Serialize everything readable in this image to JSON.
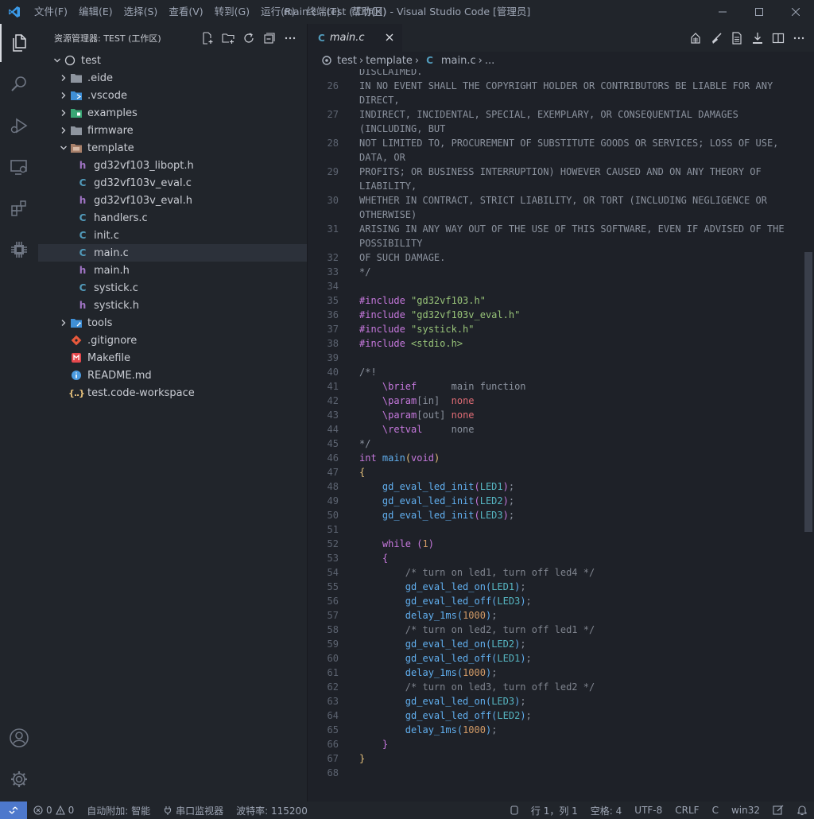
{
  "titlebar": {
    "menus": [
      "文件(F)",
      "编辑(E)",
      "选择(S)",
      "查看(V)",
      "转到(G)",
      "运行(R)",
      "终端(T)",
      "帮助(H)"
    ],
    "title": "main.c - test (工作区) - Visual Studio Code [管理员]"
  },
  "sidebar": {
    "title": "资源管理器: TEST (工作区)",
    "tree": [
      {
        "label": "test",
        "depth": 0,
        "twisty": "down",
        "icon": "root-circle-icon"
      },
      {
        "label": ".eide",
        "depth": 1,
        "twisty": "right",
        "icon": "folder-icon"
      },
      {
        "label": ".vscode",
        "depth": 1,
        "twisty": "right",
        "icon": "vscode-folder-icon"
      },
      {
        "label": "examples",
        "depth": 1,
        "twisty": "right",
        "icon": "examples-folder-icon"
      },
      {
        "label": "firmware",
        "depth": 1,
        "twisty": "right",
        "icon": "folder-icon"
      },
      {
        "label": "template",
        "depth": 1,
        "twisty": "down",
        "icon": "template-folder-icon"
      },
      {
        "label": "gd32vf103_libopt.h",
        "depth": 2,
        "twisty": "",
        "icon": "h-file-icon"
      },
      {
        "label": "gd32vf103v_eval.c",
        "depth": 2,
        "twisty": "",
        "icon": "c-file-icon"
      },
      {
        "label": "gd32vf103v_eval.h",
        "depth": 2,
        "twisty": "",
        "icon": "h-file-icon"
      },
      {
        "label": "handlers.c",
        "depth": 2,
        "twisty": "",
        "icon": "c-file-icon"
      },
      {
        "label": "init.c",
        "depth": 2,
        "twisty": "",
        "icon": "c-file-icon"
      },
      {
        "label": "main.c",
        "depth": 2,
        "twisty": "",
        "icon": "c-file-icon",
        "selected": true
      },
      {
        "label": "main.h",
        "depth": 2,
        "twisty": "",
        "icon": "h-file-icon"
      },
      {
        "label": "systick.c",
        "depth": 2,
        "twisty": "",
        "icon": "c-file-icon"
      },
      {
        "label": "systick.h",
        "depth": 2,
        "twisty": "",
        "icon": "h-file-icon"
      },
      {
        "label": "tools",
        "depth": 1,
        "twisty": "right",
        "icon": "tools-folder-icon"
      },
      {
        "label": ".gitignore",
        "depth": 1,
        "twisty": "",
        "icon": "git-file-icon"
      },
      {
        "label": "Makefile",
        "depth": 1,
        "twisty": "",
        "icon": "makefile-icon"
      },
      {
        "label": "README.md",
        "depth": 1,
        "twisty": "",
        "icon": "info-file-icon"
      },
      {
        "label": "test.code-workspace",
        "depth": 1,
        "twisty": "",
        "icon": "json-file-icon"
      }
    ]
  },
  "tab": {
    "icon_letter": "C",
    "label": "main.c"
  },
  "breadcrumb": {
    "root": "test",
    "folder": "template",
    "file_letter": "C",
    "file": "main.c",
    "tail": "..."
  },
  "code": [
    {
      "n": "",
      "parts": [
        [
          "DISCLAIMED.",
          "plain"
        ]
      ]
    },
    {
      "n": "26",
      "parts": [
        [
          "IN NO EVENT SHALL THE COPYRIGHT HOLDER OR CONTRIBUTORS BE LIABLE FOR ANY",
          "plain"
        ]
      ]
    },
    {
      "n": "",
      "parts": [
        [
          "DIRECT,",
          "plain"
        ]
      ]
    },
    {
      "n": "27",
      "parts": [
        [
          "INDIRECT, INCIDENTAL, SPECIAL, EXEMPLARY, OR CONSEQUENTIAL DAMAGES",
          "plain"
        ]
      ]
    },
    {
      "n": "",
      "parts": [
        [
          "(INCLUDING, BUT",
          "plain"
        ]
      ]
    },
    {
      "n": "28",
      "parts": [
        [
          "NOT LIMITED TO, PROCUREMENT OF SUBSTITUTE GOODS OR SERVICES; LOSS OF USE,",
          "plain"
        ]
      ]
    },
    {
      "n": "",
      "parts": [
        [
          "DATA, OR",
          "plain"
        ]
      ]
    },
    {
      "n": "29",
      "parts": [
        [
          "PROFITS; OR BUSINESS INTERRUPTION) HOWEVER CAUSED AND ON ANY THEORY OF",
          "plain"
        ]
      ]
    },
    {
      "n": "",
      "parts": [
        [
          "LIABILITY,",
          "plain"
        ]
      ]
    },
    {
      "n": "30",
      "parts": [
        [
          "WHETHER IN CONTRACT, STRICT LIABILITY, OR TORT (INCLUDING NEGLIGENCE OR",
          "plain"
        ]
      ]
    },
    {
      "n": "",
      "parts": [
        [
          "OTHERWISE)",
          "plain"
        ]
      ]
    },
    {
      "n": "31",
      "parts": [
        [
          "ARISING IN ANY WAY OUT OF THE USE OF THIS SOFTWARE, EVEN IF ADVISED OF THE",
          "plain"
        ]
      ]
    },
    {
      "n": "",
      "parts": [
        [
          "POSSIBILITY",
          "plain"
        ]
      ]
    },
    {
      "n": "32",
      "parts": [
        [
          "OF SUCH DAMAGE.",
          "plain"
        ]
      ]
    },
    {
      "n": "33",
      "parts": [
        [
          "*/",
          "plain"
        ]
      ]
    },
    {
      "n": "34",
      "parts": []
    },
    {
      "n": "35",
      "parts": [
        [
          "#include ",
          "pre"
        ],
        [
          "\"gd32vf103.h\"",
          "str"
        ]
      ]
    },
    {
      "n": "36",
      "parts": [
        [
          "#include ",
          "pre"
        ],
        [
          "\"gd32vf103v_eval.h\"",
          "str"
        ]
      ]
    },
    {
      "n": "37",
      "parts": [
        [
          "#include ",
          "pre"
        ],
        [
          "\"systick.h\"",
          "str"
        ]
      ]
    },
    {
      "n": "38",
      "parts": [
        [
          "#include ",
          "pre"
        ],
        [
          "<stdio.h>",
          "str"
        ]
      ]
    },
    {
      "n": "39",
      "parts": []
    },
    {
      "n": "40",
      "parts": [
        [
          "/*!",
          "plain"
        ]
      ]
    },
    {
      "n": "41",
      "parts": [
        [
          "    ",
          "plain"
        ],
        [
          "\\brief",
          "doc"
        ],
        [
          "      main function",
          "plain"
        ]
      ]
    },
    {
      "n": "42",
      "parts": [
        [
          "    ",
          "plain"
        ],
        [
          "\\param",
          "doc"
        ],
        [
          "[in]",
          "plain"
        ],
        [
          "  none",
          "red"
        ]
      ]
    },
    {
      "n": "43",
      "parts": [
        [
          "    ",
          "plain"
        ],
        [
          "\\param",
          "doc"
        ],
        [
          "[out]",
          "plain"
        ],
        [
          " none",
          "red"
        ]
      ]
    },
    {
      "n": "44",
      "parts": [
        [
          "    ",
          "plain"
        ],
        [
          "\\retval",
          "doc"
        ],
        [
          "     none",
          "plain"
        ]
      ]
    },
    {
      "n": "45",
      "parts": [
        [
          "*/",
          "plain"
        ]
      ]
    },
    {
      "n": "46",
      "parts": [
        [
          "int ",
          "type"
        ],
        [
          "main",
          "fn"
        ],
        [
          "(",
          "br1"
        ],
        [
          "void",
          "type"
        ],
        [
          ")",
          "br1"
        ]
      ]
    },
    {
      "n": "47",
      "parts": [
        [
          "{",
          "br1"
        ]
      ]
    },
    {
      "n": "48",
      "parts": [
        [
          "    ",
          "plain"
        ],
        [
          "gd_eval_led_init",
          "fn"
        ],
        [
          "(",
          "br2"
        ],
        [
          "LED1",
          "const"
        ],
        [
          ")",
          "br2"
        ],
        [
          ";",
          "plain"
        ]
      ]
    },
    {
      "n": "49",
      "parts": [
        [
          "    ",
          "plain"
        ],
        [
          "gd_eval_led_init",
          "fn"
        ],
        [
          "(",
          "br2"
        ],
        [
          "LED2",
          "const"
        ],
        [
          ")",
          "br2"
        ],
        [
          ";",
          "plain"
        ]
      ]
    },
    {
      "n": "50",
      "parts": [
        [
          "    ",
          "plain"
        ],
        [
          "gd_eval_led_init",
          "fn"
        ],
        [
          "(",
          "br2"
        ],
        [
          "LED3",
          "const"
        ],
        [
          ")",
          "br2"
        ],
        [
          ";",
          "plain"
        ]
      ]
    },
    {
      "n": "51",
      "parts": []
    },
    {
      "n": "52",
      "parts": [
        [
          "    ",
          "plain"
        ],
        [
          "while",
          "kw"
        ],
        [
          " ",
          "plain"
        ],
        [
          "(",
          "br2"
        ],
        [
          "1",
          "num"
        ],
        [
          ")",
          "br2"
        ]
      ]
    },
    {
      "n": "53",
      "parts": [
        [
          "    ",
          "plain"
        ],
        [
          "{",
          "br2"
        ]
      ]
    },
    {
      "n": "54",
      "parts": [
        [
          "        ",
          "plain"
        ],
        [
          "/* turn on led1, turn off led4 */",
          "com"
        ]
      ]
    },
    {
      "n": "55",
      "parts": [
        [
          "        ",
          "plain"
        ],
        [
          "gd_eval_led_on",
          "fn"
        ],
        [
          "(",
          "br3"
        ],
        [
          "LED1",
          "const"
        ],
        [
          ")",
          "br3"
        ],
        [
          ";",
          "plain"
        ]
      ]
    },
    {
      "n": "56",
      "parts": [
        [
          "        ",
          "plain"
        ],
        [
          "gd_eval_led_off",
          "fn"
        ],
        [
          "(",
          "br3"
        ],
        [
          "LED3",
          "const"
        ],
        [
          ")",
          "br3"
        ],
        [
          ";",
          "plain"
        ]
      ]
    },
    {
      "n": "57",
      "parts": [
        [
          "        ",
          "plain"
        ],
        [
          "delay_1ms",
          "fn"
        ],
        [
          "(",
          "br3"
        ],
        [
          "1000",
          "num"
        ],
        [
          ")",
          "br3"
        ],
        [
          ";",
          "plain"
        ]
      ]
    },
    {
      "n": "58",
      "parts": [
        [
          "        ",
          "plain"
        ],
        [
          "/* turn on led2, turn off led1 */",
          "com"
        ]
      ]
    },
    {
      "n": "59",
      "parts": [
        [
          "        ",
          "plain"
        ],
        [
          "gd_eval_led_on",
          "fn"
        ],
        [
          "(",
          "br3"
        ],
        [
          "LED2",
          "const"
        ],
        [
          ")",
          "br3"
        ],
        [
          ";",
          "plain"
        ]
      ]
    },
    {
      "n": "60",
      "parts": [
        [
          "        ",
          "plain"
        ],
        [
          "gd_eval_led_off",
          "fn"
        ],
        [
          "(",
          "br3"
        ],
        [
          "LED1",
          "const"
        ],
        [
          ")",
          "br3"
        ],
        [
          ";",
          "plain"
        ]
      ]
    },
    {
      "n": "61",
      "parts": [
        [
          "        ",
          "plain"
        ],
        [
          "delay_1ms",
          "fn"
        ],
        [
          "(",
          "br3"
        ],
        [
          "1000",
          "num"
        ],
        [
          ")",
          "br3"
        ],
        [
          ";",
          "plain"
        ]
      ]
    },
    {
      "n": "62",
      "parts": [
        [
          "        ",
          "plain"
        ],
        [
          "/* turn on led3, turn off led2 */",
          "com"
        ]
      ]
    },
    {
      "n": "63",
      "parts": [
        [
          "        ",
          "plain"
        ],
        [
          "gd_eval_led_on",
          "fn"
        ],
        [
          "(",
          "br3"
        ],
        [
          "LED3",
          "const"
        ],
        [
          ")",
          "br3"
        ],
        [
          ";",
          "plain"
        ]
      ]
    },
    {
      "n": "64",
      "parts": [
        [
          "        ",
          "plain"
        ],
        [
          "gd_eval_led_off",
          "fn"
        ],
        [
          "(",
          "br3"
        ],
        [
          "LED2",
          "const"
        ],
        [
          ")",
          "br3"
        ],
        [
          ";",
          "plain"
        ]
      ]
    },
    {
      "n": "65",
      "parts": [
        [
          "        ",
          "plain"
        ],
        [
          "delay_1ms",
          "fn"
        ],
        [
          "(",
          "br3"
        ],
        [
          "1000",
          "num"
        ],
        [
          ")",
          "br3"
        ],
        [
          ";",
          "plain"
        ]
      ]
    },
    {
      "n": "66",
      "parts": [
        [
          "    ",
          "plain"
        ],
        [
          "}",
          "br2"
        ]
      ]
    },
    {
      "n": "67",
      "parts": [
        [
          "}",
          "br1"
        ]
      ]
    },
    {
      "n": "68",
      "parts": []
    }
  ],
  "statusbar": {
    "errors": "0",
    "warnings": "0",
    "auto_attach": "自动附加: 智能",
    "serial_monitor": "串口监视器",
    "baud_rate": "波特率: 115200",
    "position": "行 1，列 1",
    "spaces": "空格: 4",
    "encoding": "UTF-8",
    "eol": "CRLF",
    "language": "C",
    "platform": "win32"
  },
  "colors": {
    "accent": "#4d78cc",
    "c_file": "#519aba",
    "h_file": "#a074c4"
  }
}
